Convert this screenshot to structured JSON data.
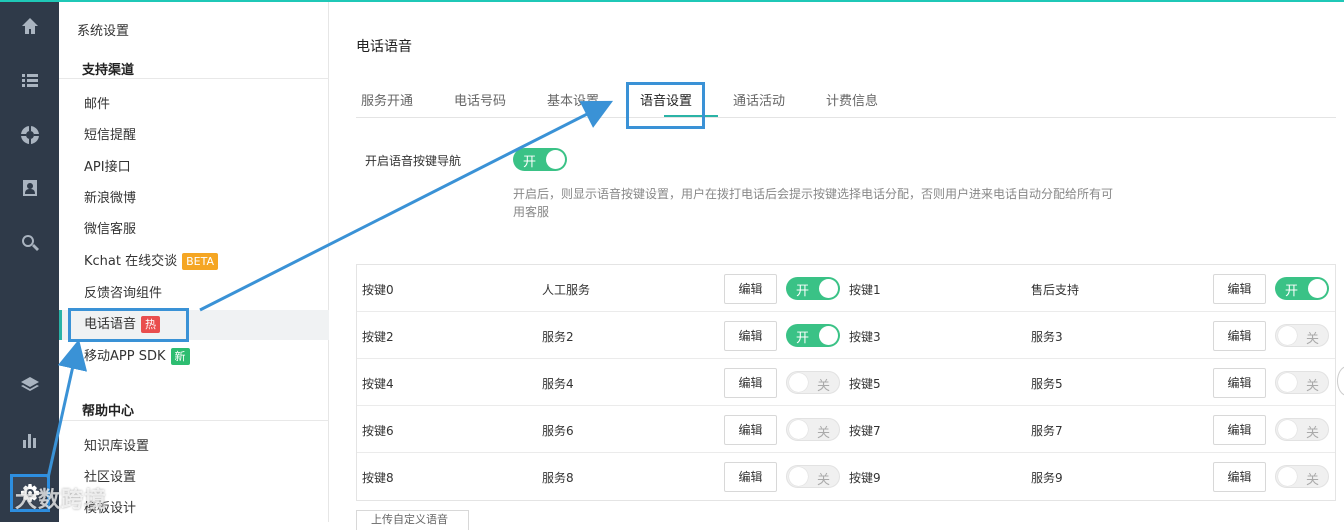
{
  "sidebar": {
    "title": "系统设置",
    "groups": [
      {
        "label": "支持渠道"
      },
      {
        "label": "帮助中心"
      }
    ],
    "items": [
      {
        "label": "邮件"
      },
      {
        "label": "短信提醒"
      },
      {
        "label": "API接口"
      },
      {
        "label": "新浪微博"
      },
      {
        "label": "微信客服"
      },
      {
        "label": "Kchat 在线交谈",
        "tag": "BETA"
      },
      {
        "label": "反馈咨询组件"
      },
      {
        "label": "电话语音",
        "tag": "热",
        "active": true
      },
      {
        "label": "移动APP SDK",
        "tag": "新"
      },
      {
        "label": "知识库设置"
      },
      {
        "label": "社区设置"
      },
      {
        "label": "模板设计"
      }
    ]
  },
  "rail": {
    "icons": [
      "home-icon",
      "list-icon",
      "support-icon",
      "contact-icon",
      "search-icon",
      "layers-icon",
      "bar-chart-icon",
      "gear-icon"
    ]
  },
  "main": {
    "title": "电话语音",
    "tabs": [
      {
        "label": "服务开通"
      },
      {
        "label": "电话号码"
      },
      {
        "label": "基本设置"
      },
      {
        "label": "语音设置",
        "active": true
      },
      {
        "label": "通话活动"
      },
      {
        "label": "计费信息"
      }
    ],
    "nav_toggle": {
      "label": "开启语音按键导航",
      "state": "开"
    },
    "description": "开启后，则显示语音按键设置，用户在拨打电话后会提示按键选择电话分配，否则用户进来电话自动分配给所有可用客服",
    "edit_label": "编辑",
    "keys": [
      {
        "key": "按键0",
        "service": "人工服务",
        "state": "开",
        "on": true
      },
      {
        "key": "按键1",
        "service": "售后支持",
        "state": "开",
        "on": true
      },
      {
        "key": "按键2",
        "service": "服务2",
        "state": "开",
        "on": true
      },
      {
        "key": "按键3",
        "service": "服务3",
        "state": "关",
        "on": false
      },
      {
        "key": "按键4",
        "service": "服务4",
        "state": "关",
        "on": false
      },
      {
        "key": "按键5",
        "service": "服务5",
        "state": "关",
        "on": false
      },
      {
        "key": "按键6",
        "service": "服务6",
        "state": "关",
        "on": false
      },
      {
        "key": "按键7",
        "service": "服务7",
        "state": "关",
        "on": false
      },
      {
        "key": "按键8",
        "service": "服务8",
        "state": "关",
        "on": false
      },
      {
        "key": "按键9",
        "service": "服务9",
        "state": "关",
        "on": false
      }
    ],
    "upload_button": "上传自定义语音"
  },
  "watermark": "大数跨境",
  "colors": {
    "accent": "#2ab3a6",
    "toggle_on": "#3ac286",
    "highlight": "#3a92d6",
    "rail": "#2f3a49"
  }
}
